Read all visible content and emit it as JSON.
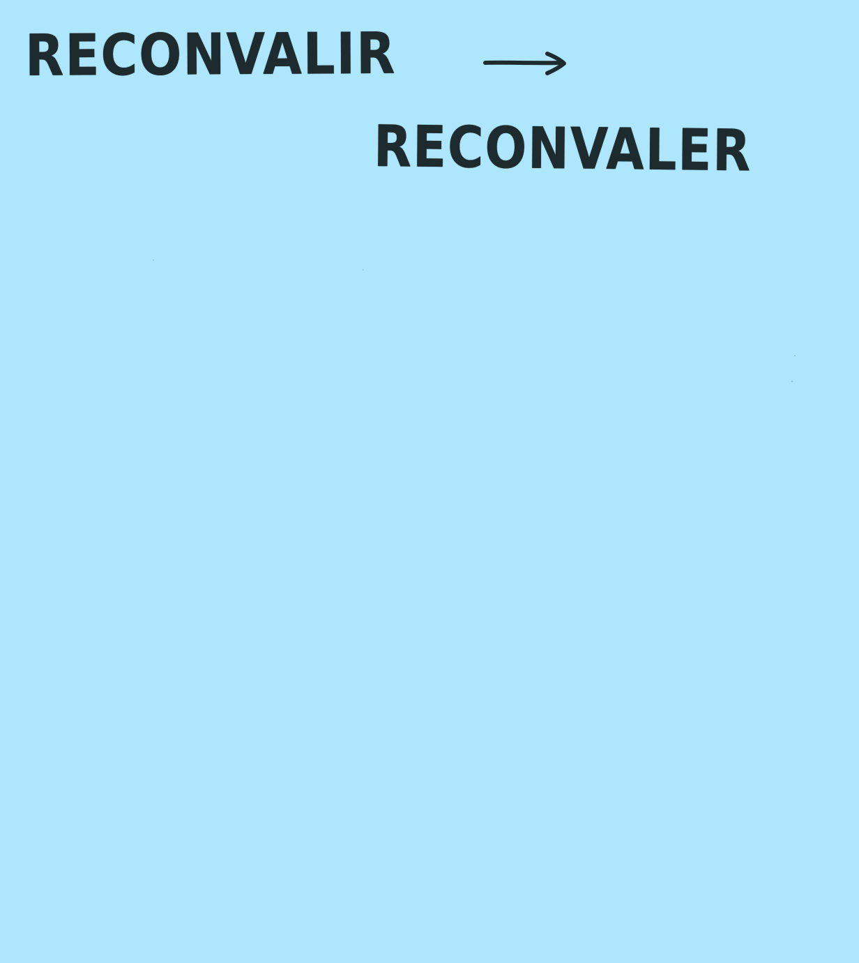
{
  "note": {
    "background_color": "#aee7fd",
    "ink_color": "#1d2a2e",
    "line_1": "RECONVALIR",
    "arrow_icon": "right-arrow-icon",
    "line_2": "RECONVALER"
  }
}
